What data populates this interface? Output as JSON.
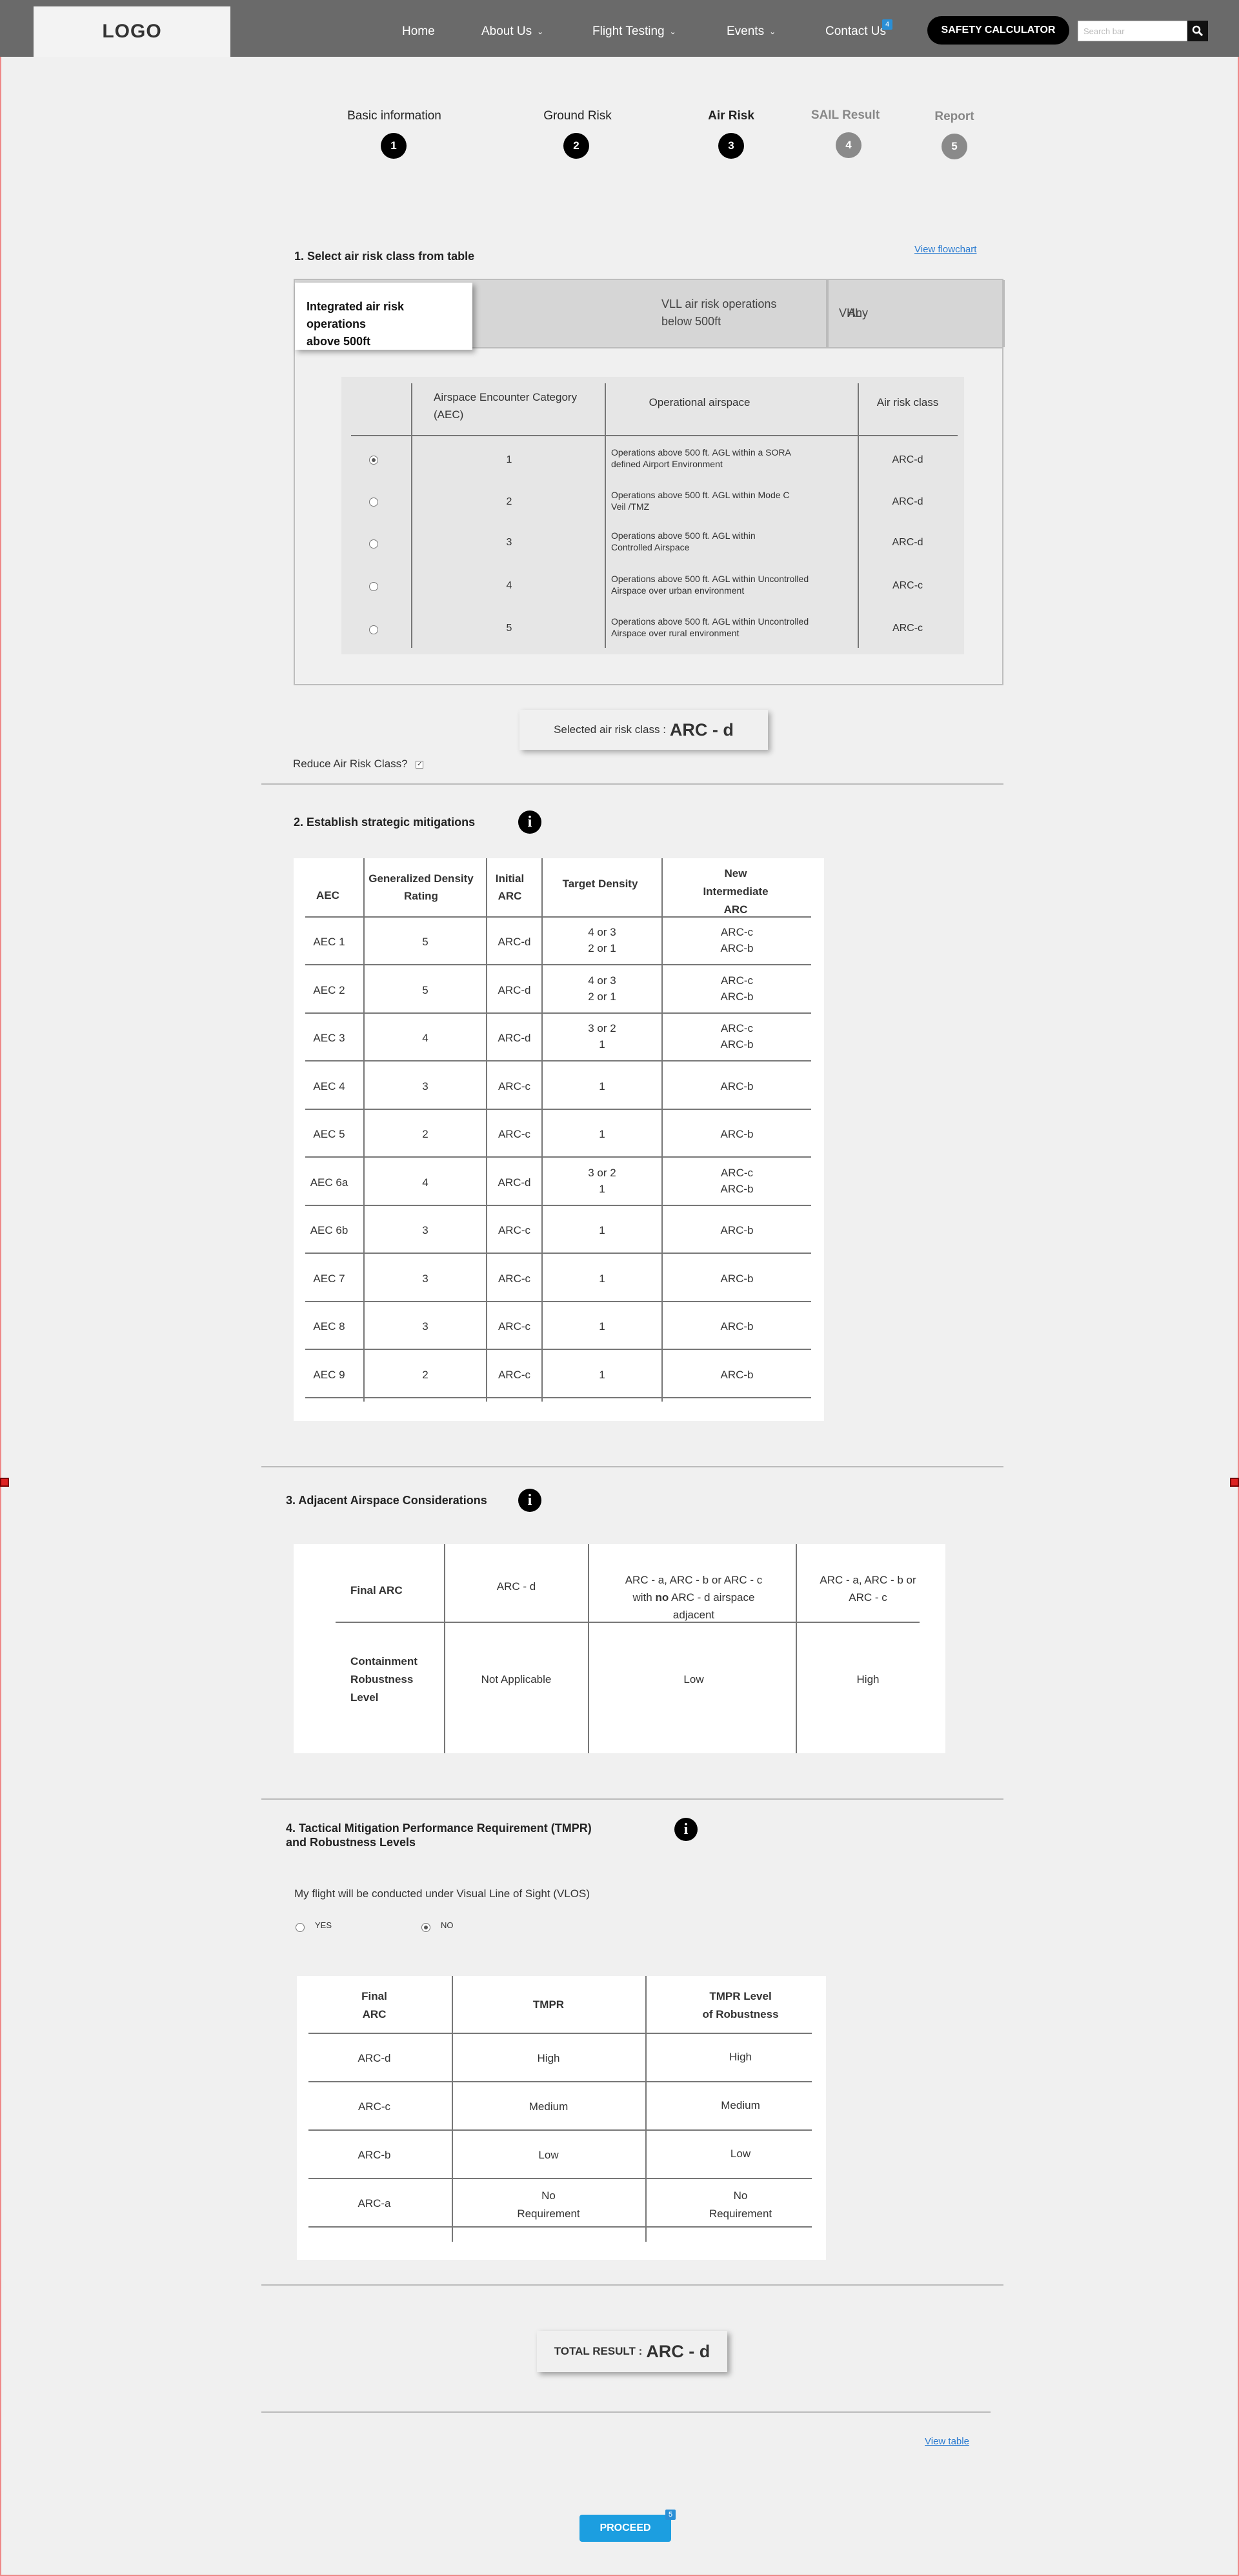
{
  "header": {
    "logo": "LOGO",
    "nav": [
      {
        "label": "Home",
        "dropdown": false
      },
      {
        "label": "About Us",
        "dropdown": true
      },
      {
        "label": "Flight Testing",
        "dropdown": true
      },
      {
        "label": "Events",
        "dropdown": true
      },
      {
        "label": "Contact Us",
        "dropdown": false
      }
    ],
    "contact_badge": "4",
    "calculator_label": "SAFETY CALCULATOR",
    "search_placeholder": "Search bar",
    "search_icon": "search-icon"
  },
  "stepper": [
    {
      "label": "Basic information",
      "number": "1",
      "active": true
    },
    {
      "label": "Ground Risk",
      "number": "2",
      "active": true
    },
    {
      "label": "Air Risk",
      "number": "3",
      "active": true,
      "current": true
    },
    {
      "label": "SAIL Result",
      "number": "4",
      "active": false
    },
    {
      "label": "Report",
      "number": "5",
      "active": false
    }
  ],
  "section1": {
    "title": "1. Select air risk class from table",
    "flowchart_link": "View flowchart",
    "tabs": [
      {
        "line1": "Integrated air risk operations",
        "line2": "above 500ft",
        "active": true
      },
      {
        "line1": "VLL air risk operations",
        "line2": "below 500ft",
        "active": false
      },
      {
        "line1": "VHL",
        "line2": "",
        "active": false
      },
      {
        "line1": "Any",
        "line2": "",
        "active": false
      }
    ],
    "table_headers": {
      "aec_line1": "Airspace Encounter Category",
      "aec_line2": "(AEC)",
      "operational": "Operational airspace",
      "class": "Air risk class"
    },
    "rows": [
      {
        "selected": true,
        "aec": "1",
        "op1": "Operations above 500 ft. AGL within a SORA",
        "op2": "defined Airport Environment",
        "arc": "ARC-d"
      },
      {
        "selected": false,
        "aec": "2",
        "op1": "Operations above 500 ft. AGL within Mode C",
        "op2": "Veil /TMZ",
        "arc": "ARC-d"
      },
      {
        "selected": false,
        "aec": "3",
        "op1": "Operations above 500 ft. AGL within",
        "op2": "Controlled Airspace",
        "arc": "ARC-d"
      },
      {
        "selected": false,
        "aec": "4",
        "op1": "Operations above 500 ft. AGL within Uncontrolled",
        "op2": "Airspace over urban environment",
        "arc": "ARC-c"
      },
      {
        "selected": false,
        "aec": "5",
        "op1": "Operations above 500 ft. AGL within Uncontrolled",
        "op2": "Airspace over rural environment",
        "arc": "ARC-c"
      }
    ],
    "selected_label": "Selected air risk class :",
    "selected_value": "ARC - d",
    "reduce_label": "Reduce Air Risk Class?"
  },
  "section2": {
    "title": "2. Establish strategic mitigations",
    "headers": {
      "aec": "AEC",
      "density_line1": "Generalized Density",
      "density_line2": "Rating",
      "initial_line1": "Initial",
      "initial_line2": "ARC",
      "target": "Target Density",
      "new_line1": "New",
      "new_line2": "Intermediate",
      "new_line3": "ARC"
    },
    "rows": [
      {
        "aec": "AEC 1",
        "density": "5",
        "initial": "ARC-d",
        "target1": "4 or 3",
        "target2": "2 or 1",
        "new1": "ARC-c",
        "new2": "ARC-b"
      },
      {
        "aec": "AEC 2",
        "density": "5",
        "initial": "ARC-d",
        "target1": "4 or 3",
        "target2": "2 or 1",
        "new1": "ARC-c",
        "new2": "ARC-b"
      },
      {
        "aec": "AEC 3",
        "density": "4",
        "initial": "ARC-d",
        "target1": "3 or 2",
        "target2": "1",
        "new1": "ARC-c",
        "new2": "ARC-b"
      },
      {
        "aec": "AEC 4",
        "density": "3",
        "initial": "ARC-c",
        "target1": "1",
        "target2": "",
        "new1": "ARC-b",
        "new2": ""
      },
      {
        "aec": "AEC 5",
        "density": "2",
        "initial": "ARC-c",
        "target1": "1",
        "target2": "",
        "new1": "ARC-b",
        "new2": ""
      },
      {
        "aec": "AEC 6a",
        "density": "4",
        "initial": "ARC-d",
        "target1": "3 or 2",
        "target2": "1",
        "new1": "ARC-c",
        "new2": "ARC-b"
      },
      {
        "aec": "AEC 6b",
        "density": "3",
        "initial": "ARC-c",
        "target1": "1",
        "target2": "",
        "new1": "ARC-b",
        "new2": ""
      },
      {
        "aec": "AEC 7",
        "density": "3",
        "initial": "ARC-c",
        "target1": "1",
        "target2": "",
        "new1": "ARC-b",
        "new2": ""
      },
      {
        "aec": "AEC 8",
        "density": "3",
        "initial": "ARC-c",
        "target1": "1",
        "target2": "",
        "new1": "ARC-b",
        "new2": ""
      },
      {
        "aec": "AEC 9",
        "density": "2",
        "initial": "ARC-c",
        "target1": "1",
        "target2": "",
        "new1": "ARC-b",
        "new2": ""
      }
    ]
  },
  "section3": {
    "title": "3. Adjacent Airspace Considerations",
    "final_arc": "Final ARC",
    "col1": "ARC - d",
    "col2_line1": "ARC - a, ARC - b or ARC - c",
    "col2_line2_pre": "with ",
    "col2_line2_bold": "no",
    "col2_line2_post": " ARC - d airspace",
    "col2_line3": "adjacent",
    "col3_line1": "ARC - a, ARC - b or",
    "col3_line2": "ARC - c",
    "row_label_1": "Containment",
    "row_label_2": "Robustness",
    "row_label_3": "Level",
    "val1": "Not Applicable",
    "val2": "Low",
    "val3": "High"
  },
  "section4": {
    "title_line1": "4. Tactical Mitigation Performance Requirement (TMPR)",
    "title_line2": "and Robustness Levels",
    "vlos_question": "My flight will be conducted under Visual Line of Sight (VLOS)",
    "yes_label": "YES",
    "no_label": "NO",
    "selected": "NO",
    "headers": {
      "final_line1": "Final",
      "final_line2": "ARC",
      "tmpr": "TMPR",
      "level_line1": "TMPR Level",
      "level_line2": "of Robustness"
    },
    "rows": [
      {
        "arc": "ARC-d",
        "tmpr1": "High",
        "tmpr2": "",
        "level1": "High",
        "level2": ""
      },
      {
        "arc": "ARC-c",
        "tmpr1": "Medium",
        "tmpr2": "",
        "level1": "Medium",
        "level2": ""
      },
      {
        "arc": "ARC-b",
        "tmpr1": "Low",
        "tmpr2": "",
        "level1": "Low",
        "level2": ""
      },
      {
        "arc": "ARC-a",
        "tmpr1": "No",
        "tmpr2": "Requirement",
        "level1": "No",
        "level2": "Requirement"
      }
    ]
  },
  "total": {
    "label": "TOTAL RESULT :",
    "value": "ARC - d"
  },
  "view_table_link": "View table",
  "proceed": {
    "label": "PROCEED",
    "badge": "5"
  },
  "colors": {
    "header_bg": "#6a6a6a",
    "page_bg": "#f0f0f0",
    "step_active": "#000000",
    "step_inactive": "#8a8a8a",
    "link": "#2a7bd0",
    "proceed": "#1c9ee0"
  }
}
